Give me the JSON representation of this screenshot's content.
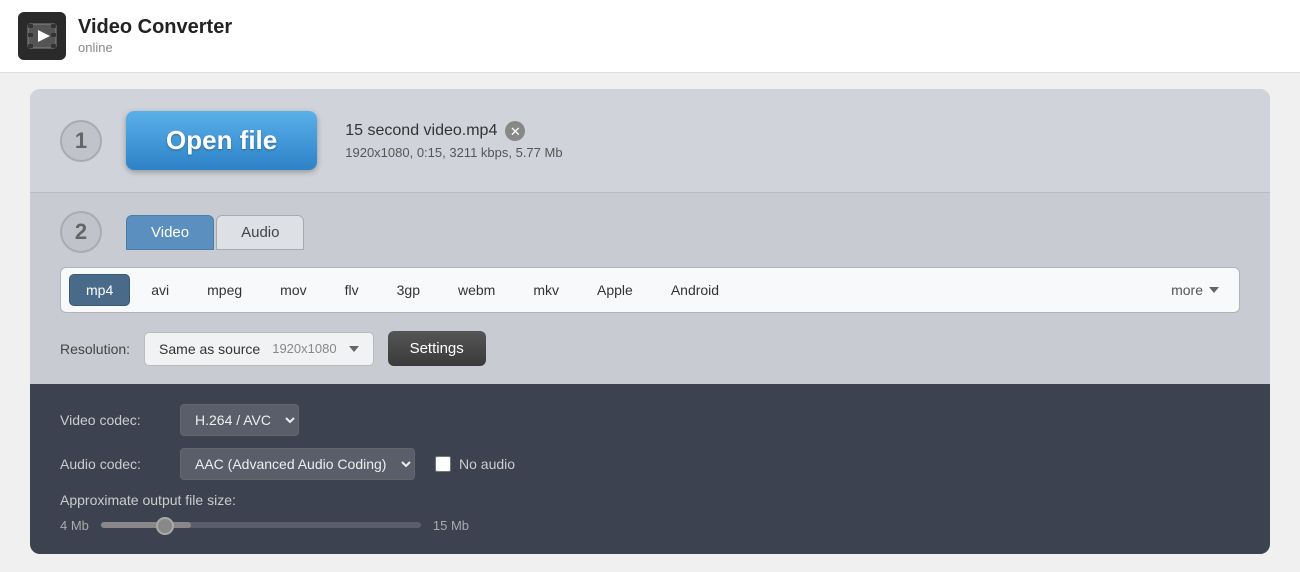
{
  "app": {
    "title": "Video Converter",
    "subtitle": "online"
  },
  "step1": {
    "number": "1",
    "open_button_label": "Open file",
    "file_name": "15 second video.mp4",
    "file_meta": "1920x1080, 0:15, 3211 kbps, 5.77 Mb"
  },
  "step2": {
    "number": "2",
    "tabs": [
      {
        "label": "Video",
        "active": true
      },
      {
        "label": "Audio",
        "active": false
      }
    ],
    "formats": [
      {
        "label": "mp4",
        "selected": true
      },
      {
        "label": "avi",
        "selected": false
      },
      {
        "label": "mpeg",
        "selected": false
      },
      {
        "label": "mov",
        "selected": false
      },
      {
        "label": "flv",
        "selected": false
      },
      {
        "label": "3gp",
        "selected": false
      },
      {
        "label": "webm",
        "selected": false
      },
      {
        "label": "mkv",
        "selected": false
      },
      {
        "label": "Apple",
        "selected": false
      },
      {
        "label": "Android",
        "selected": false
      }
    ],
    "more_label": "more",
    "resolution_label": "Resolution:",
    "resolution_value": "Same as source",
    "resolution_detail": "1920x1080",
    "settings_label": "Settings"
  },
  "step3": {
    "video_codec_label": "Video codec:",
    "video_codec_value": "H.264 / AVC",
    "audio_codec_label": "Audio codec:",
    "audio_codec_value": "AAC (Advanced Audio Coding)",
    "no_audio_label": "No audio",
    "filesize_label": "Approximate output file size:",
    "filesize_min": "4 Mb",
    "filesize_max": "15 Mb"
  }
}
